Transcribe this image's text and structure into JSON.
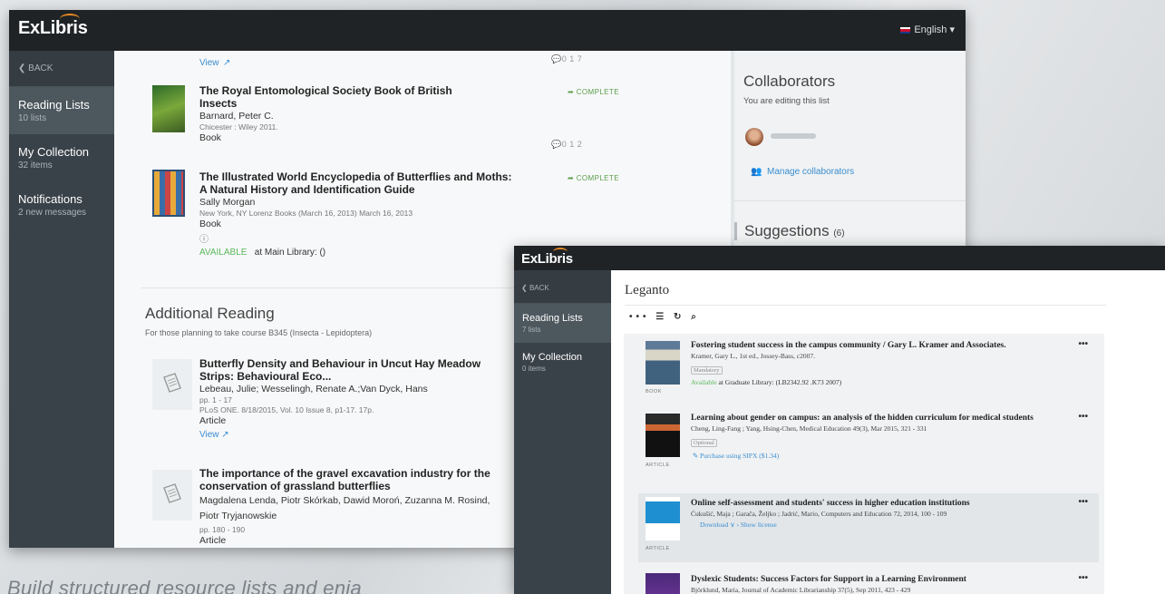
{
  "w1": {
    "logo": "ExLibris",
    "language": "English",
    "back": "BACK",
    "nav": [
      {
        "title": "Reading Lists",
        "sub": "10 lists"
      },
      {
        "title": "My Collection",
        "sub": "32 items"
      },
      {
        "title": "Notifications",
        "sub": "2 new messages"
      }
    ],
    "top_view": "View",
    "top_stats": "0 1 7",
    "items": [
      {
        "title": "The Royal Entomological Society Book of British Insects",
        "author": "Barnard, Peter C.",
        "pub": "Chicester : Wiley 2011.",
        "type": "Book",
        "status": "COMPLETE",
        "stats": "0 1 2"
      },
      {
        "title": "The Illustrated World Encyclopedia of Butterflies and Moths: A Natural History and Identification Guide",
        "author": "Sally Morgan",
        "pub": "New York, NY Lorenz Books (March 16, 2013) March 16, 2013",
        "type": "Book",
        "status": "COMPLETE",
        "availability": "AVAILABLE",
        "availability_loc": "at Main Library: ()"
      }
    ],
    "section": {
      "title": "Additional Reading",
      "sub": "For those planning to take course B345 (Insecta - Lepidoptera)"
    },
    "articles": [
      {
        "title": "Butterfly Density and Behaviour in Uncut Hay Meadow Strips: Behavioural Eco...",
        "author": "Lebeau, Julie; Wesselingh, Renate A.;Van Dyck, Hans",
        "pages": "pp. 1 - 17",
        "pub": "PLoS ONE. 8/18/2015, Vol. 10 Issue 8, p1-17. 17p.",
        "type": "Article",
        "view": "View"
      },
      {
        "title": "The importance of the gravel excavation industry for the conservation of grassland butterflies",
        "author": "Magdalena Lenda, Piotr Skórkab, Dawid Moroń, Zuzanna M. Rosind, Piotr Tryjanowskie",
        "pages": "pp. 180 - 190",
        "type": "Article"
      }
    ],
    "right": {
      "collab_title": "Collaborators",
      "collab_sub": "You are editing this list",
      "manage": "Manage collaborators",
      "suggest_title": "Suggestions",
      "suggest_count": "(6)"
    }
  },
  "w2": {
    "logo": "ExLibris",
    "back": "BACK",
    "nav": [
      {
        "title": "Reading Lists",
        "sub": "7 lists"
      },
      {
        "title": "My Collection",
        "sub": "0 items"
      }
    ],
    "title": "Leganto",
    "cards": [
      {
        "title": "Fostering student success in the campus community / Gary L. Kramer and Associates.",
        "author": "Kramer, Gary L., 1st ed., Jossey-Bass, c2007.",
        "badge": "Mandatory",
        "avail": "Available",
        "avail_loc": "at Graduate Library: (LB2342.92 .K73 2007)",
        "type": "BOOK"
      },
      {
        "title": "Learning about gender on campus: an analysis of the hidden curriculum for medical students",
        "author": "Cheng, Ling-Fang ; Yang, Hsing-Chen, Medical Education 49(3), Mar 2015, 321 - 331",
        "badge": "Optional",
        "link": "Purchase using SIPX ($1.34)",
        "type": "ARTICLE"
      },
      {
        "title": "Online self-assessment and students' success in higher education institutions",
        "author": "Ćukušić, Maja ; Garača, Željko ; Jadrić, Mario, Computers and Education 72, 2014, 100 - 109",
        "link": "Download ∨  ›  Show license",
        "type": "ARTICLE"
      },
      {
        "title": "Dyslexic Students: Success Factors for Support in a Learning Environment",
        "author": "Björklund, Maria, Journal of Academic Librarianship 37(5), Sep 2011, 423 - 429"
      }
    ]
  },
  "tagline": "Build structured resource lists and enja"
}
